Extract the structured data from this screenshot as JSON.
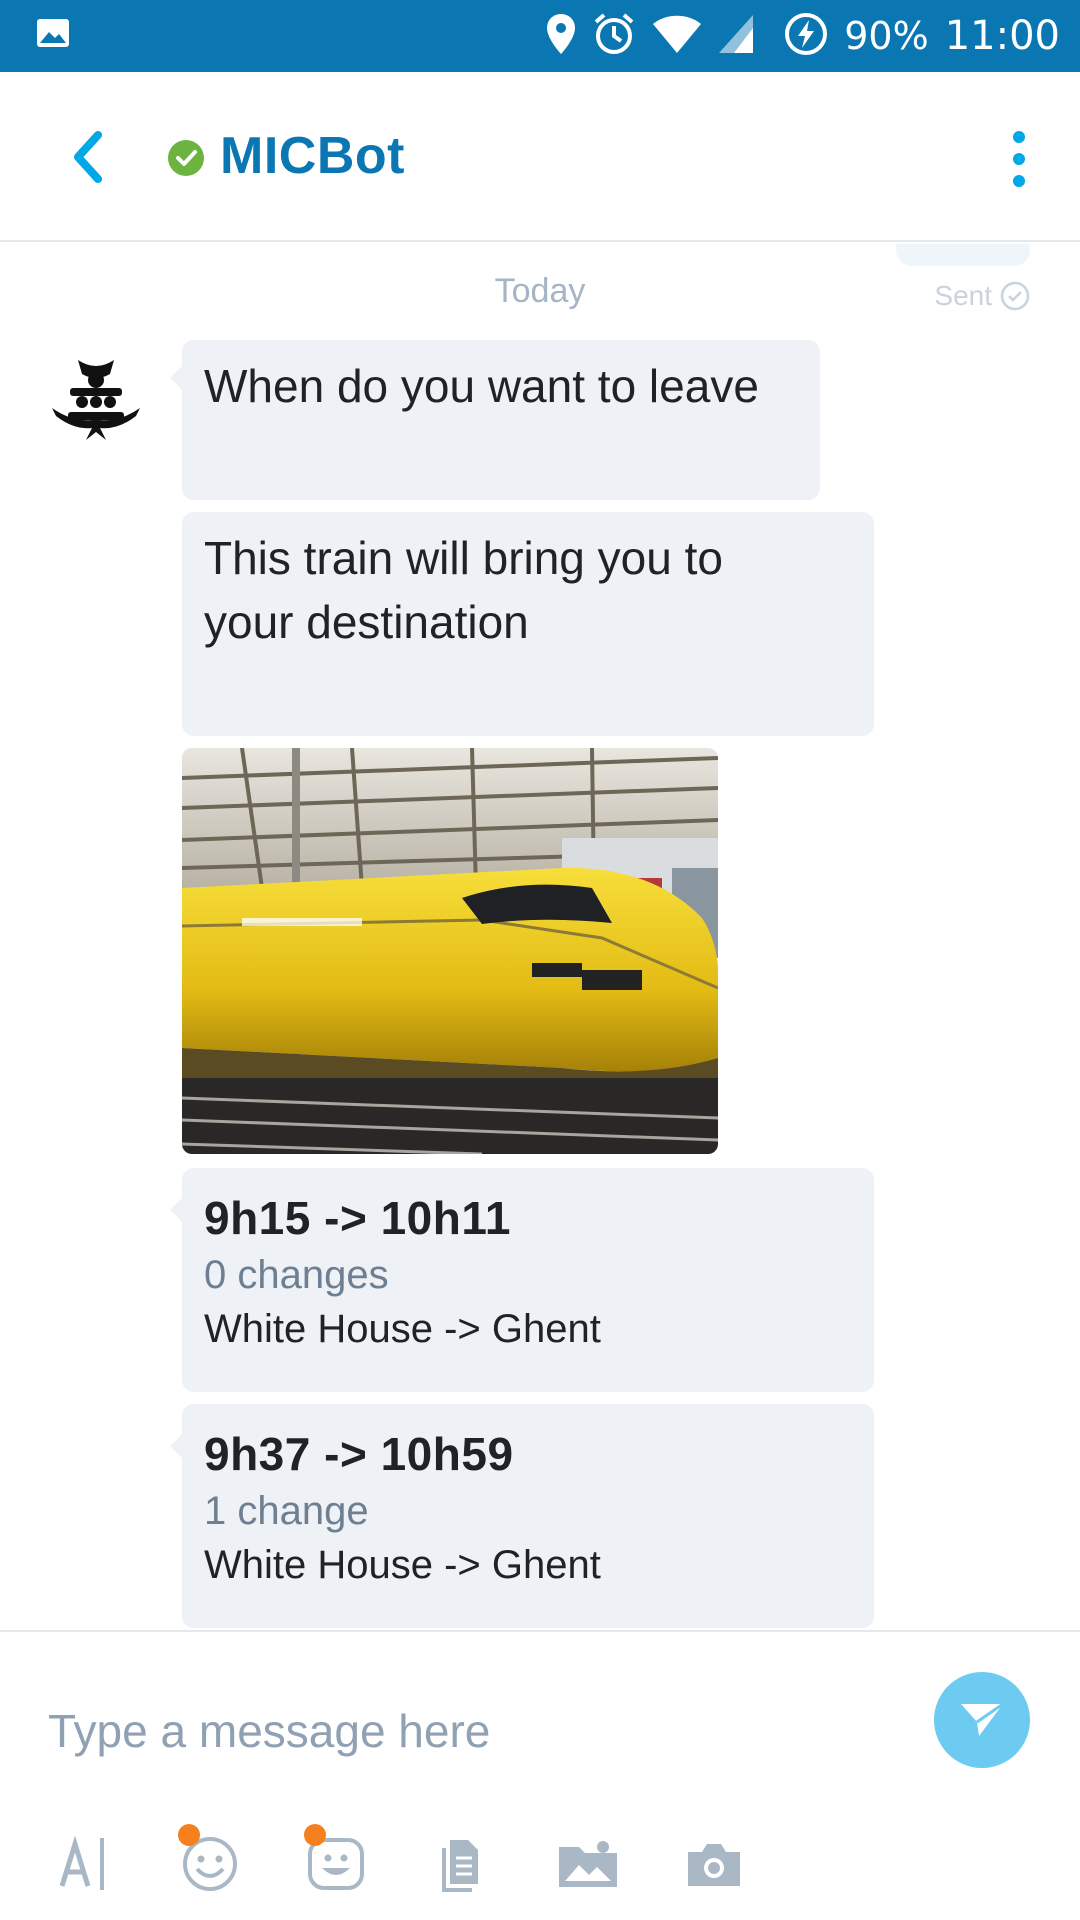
{
  "status_bar": {
    "battery_percent": "90%",
    "time": "11:00",
    "icons": [
      "image-icon",
      "location-icon",
      "alarm-icon",
      "wifi-icon",
      "signal-icon",
      "battery-charging-icon"
    ],
    "background": "#0a77b3"
  },
  "header": {
    "title": "MICBot",
    "presence": "online",
    "accent": "#0a77b3",
    "presence_color": "#6cb33f"
  },
  "conversation": {
    "date_separator": "Today",
    "sent_status": "Sent",
    "messages": [
      {
        "text": "When do you want to leave"
      },
      {
        "text": "This train will bring you to your destination"
      }
    ],
    "image_alt": "yellow high-speed train at station",
    "cards": [
      {
        "time": "9h15 -> 10h11",
        "changes": "0 changes",
        "route": "White House -> Ghent"
      },
      {
        "time": "9h37 -> 10h59",
        "changes": "1 change",
        "route": "White House -> Ghent"
      }
    ]
  },
  "composer": {
    "placeholder": "Type a message here",
    "tools": [
      "text-format-icon",
      "emoticon-icon",
      "moji-icon",
      "file-icon",
      "media-icon",
      "camera-icon"
    ]
  }
}
